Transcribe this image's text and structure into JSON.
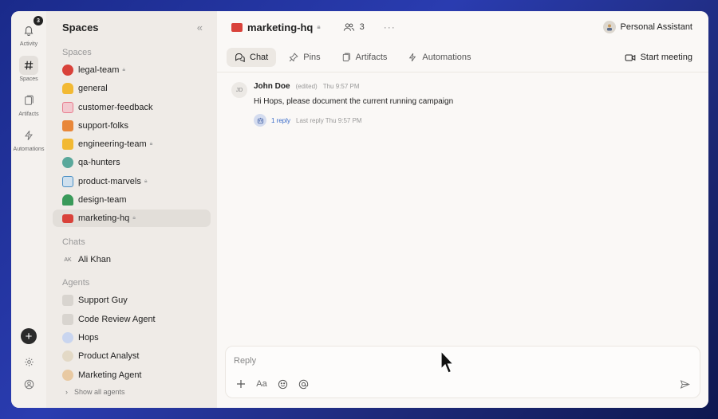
{
  "rail": {
    "activity": {
      "label": "Activity",
      "badge": "3",
      "icon": "bell-icon"
    },
    "spaces": {
      "label": "Spaces",
      "icon": "hash-icon"
    },
    "artifacts": {
      "label": "Artifacts",
      "icon": "artifact-icon"
    },
    "automations": {
      "label": "Automations",
      "icon": "lightning-icon"
    },
    "add": "+"
  },
  "sidebar": {
    "title": "Spaces",
    "spaces_label": "Spaces",
    "spaces": [
      {
        "name": "legal-team",
        "locked": true,
        "color": "#d9423a"
      },
      {
        "name": "general",
        "locked": false,
        "color": "#f2b933"
      },
      {
        "name": "customer-feedback",
        "locked": false,
        "color": "#e87c8e"
      },
      {
        "name": "support-folks",
        "locked": false,
        "color": "#e8873a"
      },
      {
        "name": "engineering-team",
        "locked": true,
        "color": "#f2b933"
      },
      {
        "name": "qa-hunters",
        "locked": false,
        "color": "#5aa89b"
      },
      {
        "name": "product-marvels",
        "locked": true,
        "color": "#4a8fc4"
      },
      {
        "name": "design-team",
        "locked": false,
        "color": "#3a9a5a"
      },
      {
        "name": "marketing-hq",
        "locked": true,
        "color": "#d9423a"
      }
    ],
    "chats_label": "Chats",
    "chats": [
      {
        "initials": "AK",
        "name": "Ali Khan"
      }
    ],
    "agents_label": "Agents",
    "agents": [
      {
        "name": "Support Guy"
      },
      {
        "name": "Code Review Agent"
      },
      {
        "name": "Hops"
      },
      {
        "name": "Product Analyst"
      },
      {
        "name": "Marketing Agent"
      }
    ],
    "show_all": "Show all agents"
  },
  "header": {
    "channel": "marketing-hq",
    "members": "3",
    "more": "···",
    "assistant": "Personal Assistant"
  },
  "tabs": {
    "chat": "Chat",
    "pins": "Pins",
    "artifacts": "Artifacts",
    "automations": "Automations",
    "start_meeting": "Start meeting"
  },
  "message": {
    "initials": "JD",
    "author": "John Doe",
    "edited": "(edited)",
    "time": "Thu 9:57 PM",
    "text": "Hi Hops, please document the current running campaign",
    "reply_count": "1 reply",
    "last_reply": "Last reply Thu 9:57 PM"
  },
  "composer": {
    "placeholder": "Reply",
    "format": "Aa"
  }
}
